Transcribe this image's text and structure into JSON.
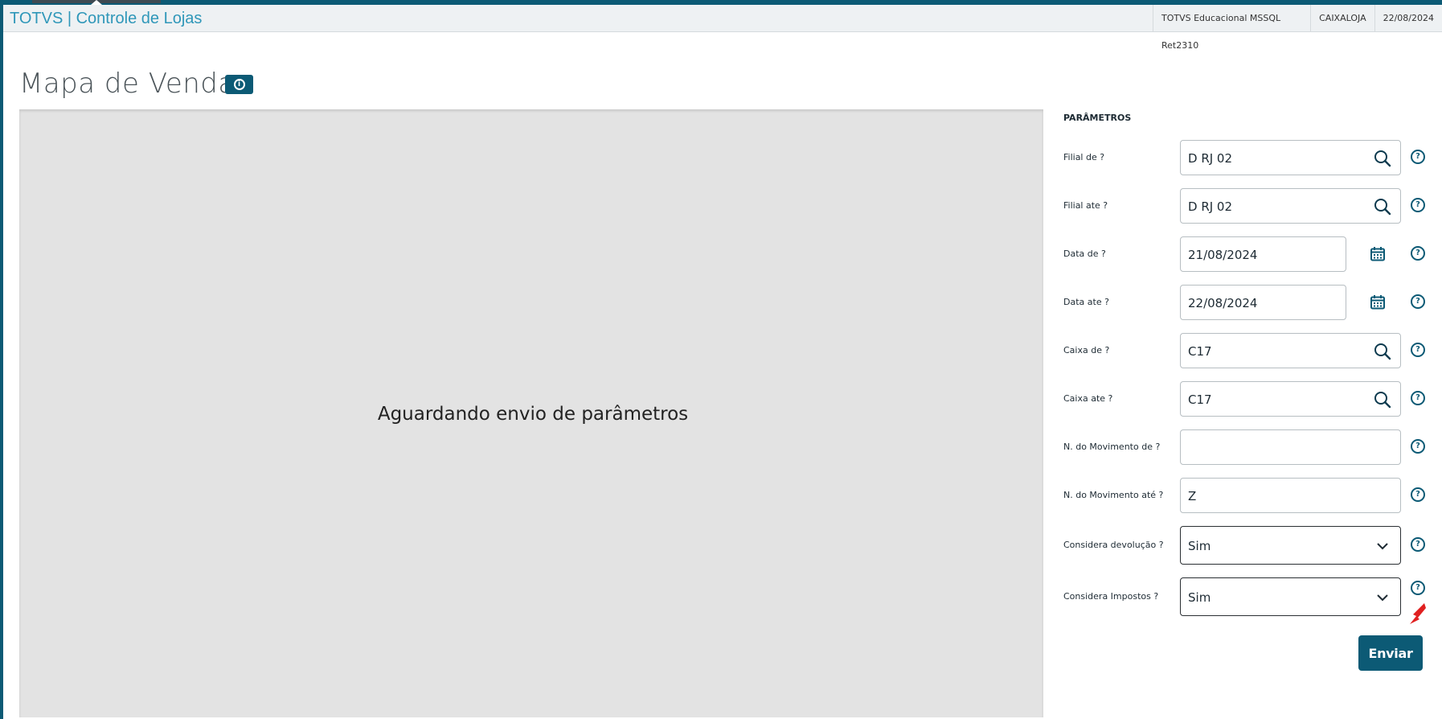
{
  "header": {
    "app_title": "TOTVS | Controle de Lojas",
    "environment": "TOTVS Educacional MSSQL Ret2310",
    "user": "CAIXALOJA",
    "date": "22/08/2024"
  },
  "page": {
    "title": "Mapa de Vendas",
    "info_icon": "info-icon",
    "waiting_message": "Aguardando envio de parâmetros"
  },
  "params": {
    "section_title": "PARÂMETROS",
    "fields": [
      {
        "label": "Filial de ?",
        "value": "D RJ 02",
        "kind": "lookup"
      },
      {
        "label": "Filial ate ?",
        "value": "D RJ 02",
        "kind": "lookup"
      },
      {
        "label": "Data de ?",
        "value": "21/08/2024",
        "kind": "date"
      },
      {
        "label": "Data ate ?",
        "value": "22/08/2024",
        "kind": "date"
      },
      {
        "label": "Caixa de ?",
        "value": "C17",
        "kind": "lookup"
      },
      {
        "label": "Caixa ate ?",
        "value": "C17",
        "kind": "lookup"
      },
      {
        "label": "N. do Movimento de ?",
        "value": "",
        "kind": "text"
      },
      {
        "label": "N. do Movimento até ?",
        "value": "Z",
        "kind": "text"
      },
      {
        "label": "Considera devolução ?",
        "value": "Sim",
        "kind": "select"
      },
      {
        "label": "Considera Impostos ?",
        "value": "Sim",
        "kind": "select"
      }
    ],
    "help_glyph": "?",
    "submit_label": "Enviar"
  },
  "colors": {
    "primary": "#0c5a75",
    "title_link": "#2f97b9",
    "panel_bg": "#e3e3e3",
    "annotation": "#e02020"
  }
}
